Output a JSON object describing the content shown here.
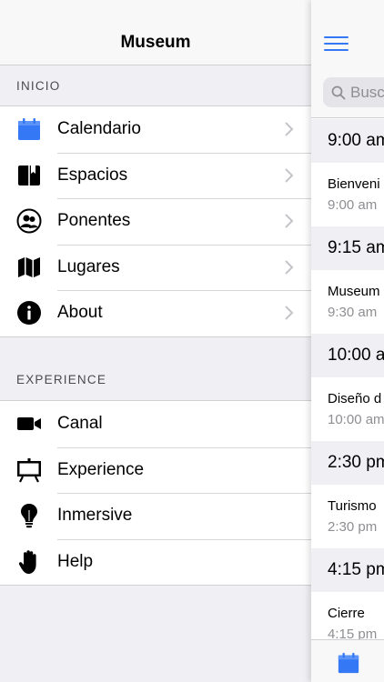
{
  "menu": {
    "title": "Museum",
    "sections": [
      {
        "label": "INICIO",
        "items": [
          {
            "label": "Calendario",
            "icon": "calendar-icon"
          },
          {
            "label": "Espacios",
            "icon": "bookmark-book-icon"
          },
          {
            "label": "Ponentes",
            "icon": "people-icon"
          },
          {
            "label": "Lugares",
            "icon": "map-icon"
          },
          {
            "label": "About",
            "icon": "info-icon"
          }
        ]
      },
      {
        "label": "EXPERIENCE",
        "items": [
          {
            "label": "Canal",
            "icon": "video-camera-icon"
          },
          {
            "label": "Experience",
            "icon": "easel-board-icon"
          },
          {
            "label": "Inmersive",
            "icon": "lightbulb-icon"
          },
          {
            "label": "Help",
            "icon": "hand-icon"
          }
        ]
      }
    ]
  },
  "main": {
    "search_placeholder": "Busc",
    "agenda": [
      {
        "header": "9:00 am",
        "event_title": "Bienveni",
        "event_time": "9:00 am"
      },
      {
        "header": "9:15 am",
        "event_title": "Museum",
        "event_time": "9:30 am"
      },
      {
        "header": "10:00 a",
        "event_title": "Diseño d",
        "event_time": "10:00 am"
      },
      {
        "header": "2:30 pm",
        "event_title": "Turismo",
        "event_time": "2:30 pm"
      },
      {
        "header": "4:15 pm",
        "event_title": "Cierre",
        "event_time": "4:15 pm"
      }
    ],
    "tabbar_icon": "calendar-icon"
  },
  "colors": {
    "accent": "#3478f6",
    "secondary_text": "#8e8e93",
    "grouped_bg": "#efeff4"
  }
}
